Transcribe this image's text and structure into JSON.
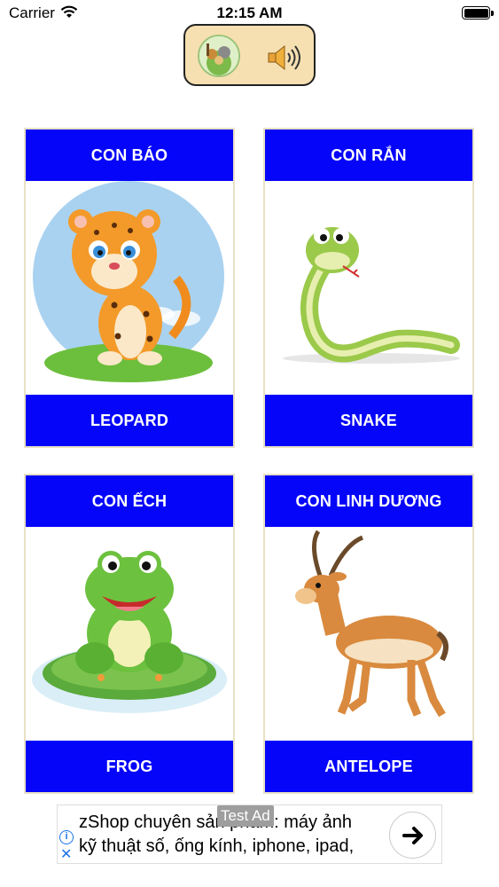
{
  "status_bar": {
    "carrier": "Carrier",
    "time": "12:15 AM"
  },
  "top_panel": {
    "logo_icon": "animals-logo-icon",
    "sound_icon": "speaker-icon"
  },
  "cards": [
    {
      "top_label": "CON BÁO",
      "bottom_label": "LEOPARD",
      "image": "leopard"
    },
    {
      "top_label": "CON RẮN",
      "bottom_label": "SNAKE",
      "image": "snake"
    },
    {
      "top_label": "CON ẾCH",
      "bottom_label": "FROG",
      "image": "frog"
    },
    {
      "top_label": "CON LINH DƯƠNG",
      "bottom_label": "ANTELOPE",
      "image": "antelope"
    }
  ],
  "ad": {
    "badge": "Test Ad",
    "line1": "zShop chuyên sản phẩm: máy ảnh",
    "line2": "kỹ thuật số, ống kính, iphone, ipad,",
    "colors": {
      "card_header": "#0505fa",
      "panel": "#f6e0b1"
    }
  }
}
